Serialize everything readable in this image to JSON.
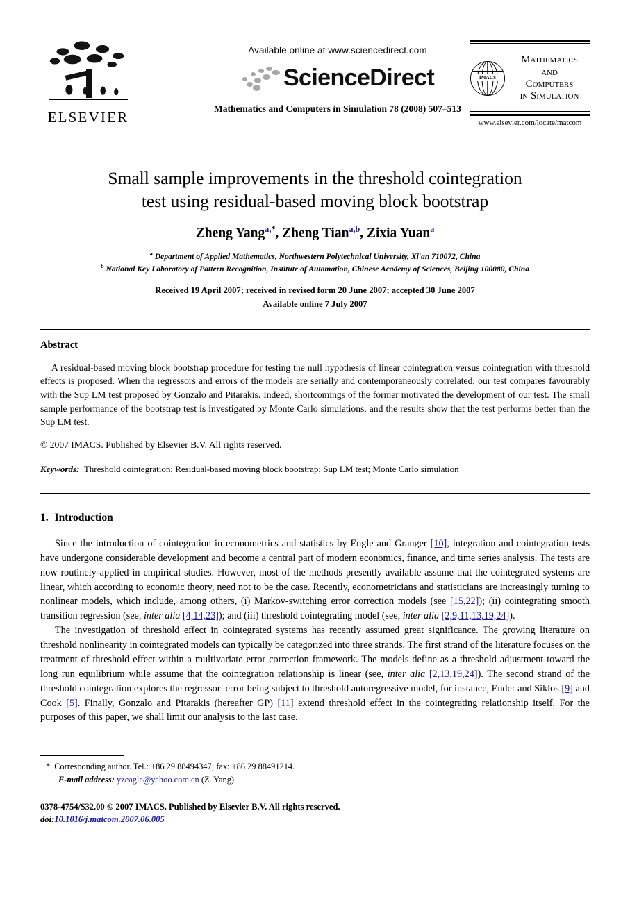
{
  "masthead": {
    "elsevier_wordmark": "ELSEVIER",
    "available_online": "Available online at www.sciencedirect.com",
    "sciencedirect_name": "ScienceDirect",
    "journal_citation": "Mathematics and Computers in Simulation 78 (2008) 507–513",
    "journal_logo_lines": [
      "Mathematics",
      "and",
      "Computers",
      "in Simulation"
    ],
    "journal_logo_globe_text": "IMACS",
    "journal_url": "www.elsevier.com/locate/matcom"
  },
  "title": {
    "line1": "Small sample improvements in the threshold cointegration",
    "line2": "test using residual-based moving block bootstrap"
  },
  "authors": {
    "a1_name": "Zheng Yang",
    "a1_sup": "a",
    "a1_star": ",*",
    "sep1": ", ",
    "a2_name": "Zheng Tian",
    "a2_sup": "a,b",
    "sep2": ", ",
    "a3_name": "Zixia Yuan",
    "a3_sup": "a"
  },
  "affiliations": [
    {
      "marker": "a",
      "text": "Department of Applied Mathematics, Northwestern Polytechnical University, Xi'an 710072, China"
    },
    {
      "marker": "b",
      "text": "National Key Laboratory of Pattern Recognition, Institute of Automation, Chinese Academy of Sciences, Beijing 100080, China"
    }
  ],
  "history": {
    "line1": "Received 19 April 2007; received in revised form 20 June 2007; accepted 30 June 2007",
    "line2": "Available online 7 July 2007"
  },
  "abstract": {
    "heading": "Abstract",
    "body": "A residual-based moving block bootstrap procedure for testing the null hypothesis of linear cointegration versus cointegration with threshold effects is proposed. When the regressors and errors of the models are serially and contemporaneously correlated, our test compares favourably with the Sup LM test proposed by Gonzalo and Pitarakis. Indeed, shortcomings of the former motivated the development of our test. The small sample performance of the bootstrap test is investigated by Monte Carlo simulations, and the results show that the test performs better than the Sup LM test.",
    "copyright": "© 2007 IMACS. Published by Elsevier B.V. All rights reserved.",
    "keywords_label": "Keywords:",
    "keywords_value": "Threshold cointegration; Residual-based moving block bootstrap; Sup LM test; Monte Carlo simulation"
  },
  "introduction": {
    "number": "1.",
    "heading": "Introduction",
    "par1": {
      "t1": "Since the introduction of cointegration in econometrics and statistics by Engle and Granger ",
      "c1": "[10]",
      "t2": ", integration and cointegration tests have undergone considerable development and become a central part of modern economics, finance, and time series analysis. The tests are now routinely applied in empirical studies. However, most of the methods presently available assume that the cointegrated systems are linear, which according to economic theory, need not to be the case. Recently, econometricians and statisticians are increasingly turning to nonlinear models, which include, among others, (i) Markov-switching error correction models (see ",
      "c2": "[15,22]",
      "t3": "); (ii) cointegrating smooth transition regression (see, ",
      "i1": "inter alia",
      "t4": " ",
      "c3": "[4,14,23]",
      "t5": "); and (iii) threshold cointegrating model (see, ",
      "i2": "inter alia",
      "t6": " ",
      "c4": "[2,9,11,13,19,24]",
      "t7": ")."
    },
    "par2": {
      "t1": "The investigation of threshold effect in cointegrated systems has recently assumed great significance. The growing literature on threshold nonlinearity in cointegrated models can typically be categorized into three strands. The first strand of the literature focuses on the treatment of threshold effect within a multivariate error correction framework. The models define as a threshold adjustment toward the long run equilibrium while assume that the cointegration relationship is linear (see, ",
      "i1": "inter alia",
      "t2": " ",
      "c1": "[2,13,19,24]",
      "t3": "). The second strand of the threshold cointegration explores the regressor–error being subject to threshold autoregressive model, for instance, Ender and Siklos ",
      "c2": "[9]",
      "t4": " and Cook ",
      "c3": "[5]",
      "t5": ". Finally, Gonzalo and Pitarakis (hereafter GP) ",
      "c4": "[11]",
      "t6": " extend threshold effect in the cointegrating relationship itself. For the purposes of this paper, we shall limit our analysis to the last case."
    }
  },
  "footnotes": {
    "corresponding": "Corresponding author. Tel.: +86 29 88494347; fax: +86 29 88491214.",
    "email_label": "E-mail address:",
    "email": "yzeagle@yahoo.com.cn",
    "email_suffix": "(Z. Yang)."
  },
  "imprint": {
    "issn_line": "0378-4754/$32.00 © 2007 IMACS. Published by Elsevier B.V. All rights reserved.",
    "doi_label": "doi:",
    "doi_value": "10.1016/j.matcom.2007.06.005"
  },
  "colors": {
    "link": "#16199c",
    "text": "#000000",
    "logo_gray": "#a7a7a7"
  }
}
